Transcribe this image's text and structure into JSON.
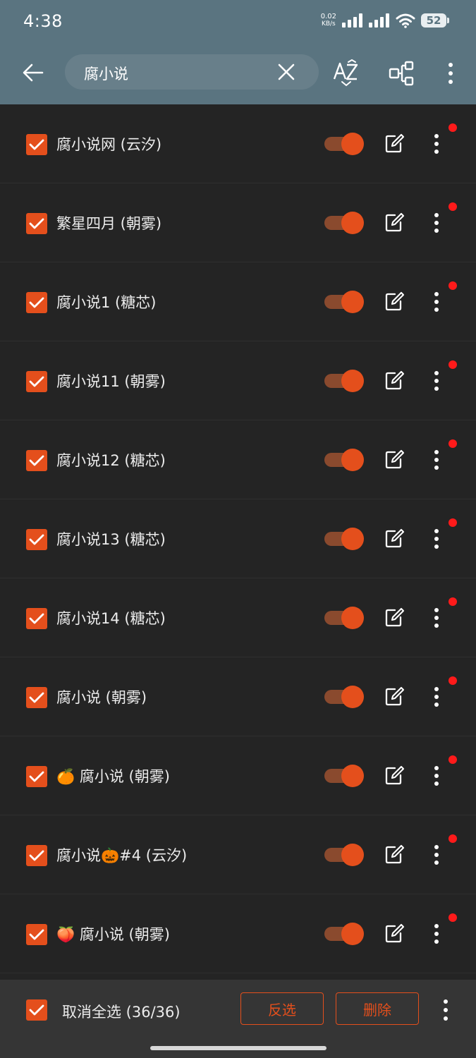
{
  "status_bar": {
    "time": "4:38",
    "net_speed_value": "0.02",
    "net_speed_unit": "KB/s",
    "battery": "52"
  },
  "toolbar": {
    "search_value": "腐小说",
    "back_icon": "arrow-left-icon",
    "clear_icon": "close-icon",
    "sort_icon": "az-sort-icon",
    "group_icon": "group-icon",
    "menu_icon": "more-vertical-icon"
  },
  "sources": [
    {
      "name": "腐小说网 (云汐)",
      "enabled": true,
      "selected": true
    },
    {
      "name": "繁星四月 (朝雾)",
      "enabled": true,
      "selected": true
    },
    {
      "name": "腐小说1 (糖芯)",
      "enabled": true,
      "selected": true
    },
    {
      "name": "腐小说11 (朝雾)",
      "enabled": true,
      "selected": true
    },
    {
      "name": "腐小说12 (糖芯)",
      "enabled": true,
      "selected": true
    },
    {
      "name": "腐小说13 (糖芯)",
      "enabled": true,
      "selected": true
    },
    {
      "name": "腐小说14 (糖芯)",
      "enabled": true,
      "selected": true
    },
    {
      "name": "腐小说 (朝雾)",
      "enabled": true,
      "selected": true
    },
    {
      "name": "🍊 腐小说 (朝雾)",
      "enabled": true,
      "selected": true
    },
    {
      "name": "腐小说🎃#4 (云汐)",
      "enabled": true,
      "selected": true
    },
    {
      "name": "🍑 腐小说 (朝雾)",
      "enabled": true,
      "selected": true
    }
  ],
  "bottom_bar": {
    "select_all_label": "取消全选 (36/36)",
    "invert_label": "反选",
    "delete_label": "删除"
  },
  "colors": {
    "accent": "#e44f1c",
    "toolbar": "#5a7480",
    "background": "#242424",
    "badge": "#ff1a1a"
  }
}
